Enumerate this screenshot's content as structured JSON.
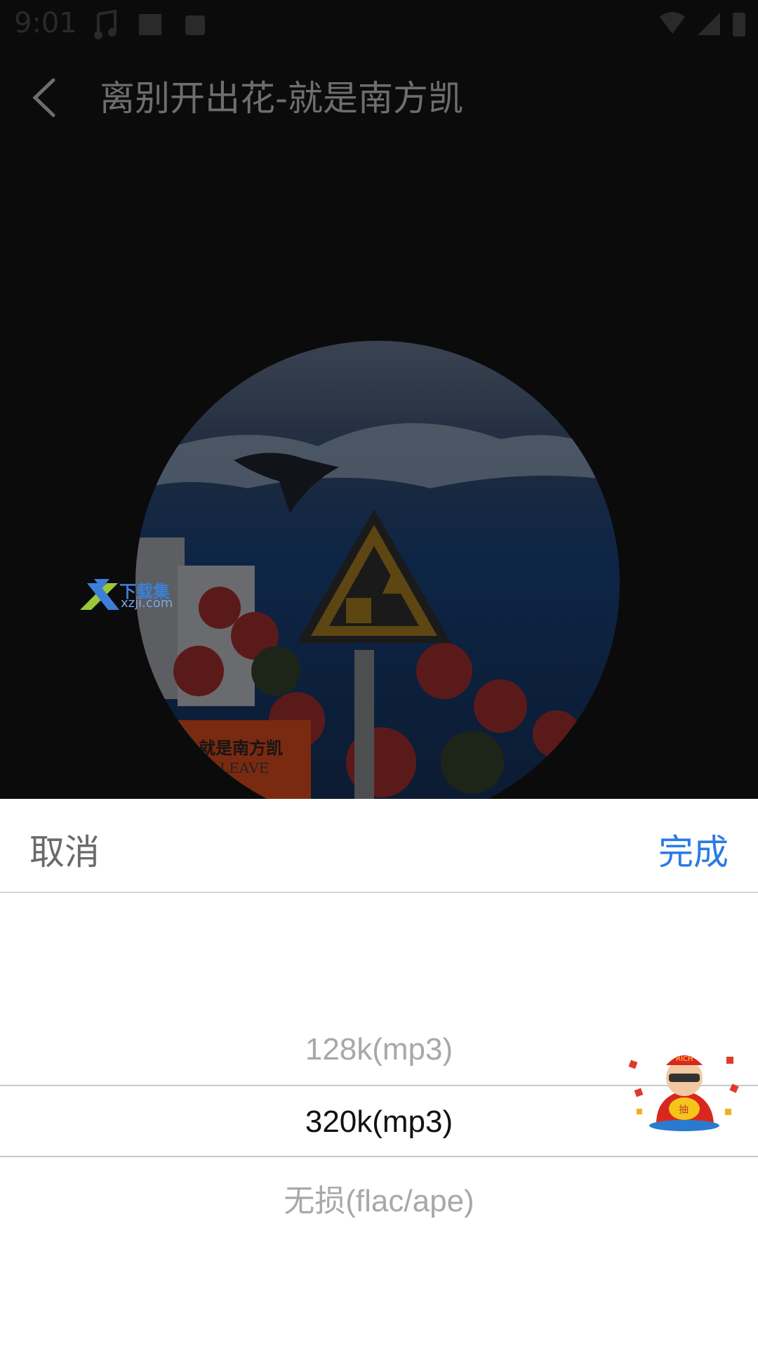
{
  "status_bar": {
    "time": "9:01"
  },
  "header": {
    "title": "离别开出花-就是南方凯"
  },
  "album": {
    "cover_text": "就是南方凯",
    "cover_text2": "LEAVE"
  },
  "watermark": {
    "name": "下载集",
    "domain": "xzji.com"
  },
  "sheet": {
    "cancel_label": "取消",
    "done_label": "完成",
    "options": [
      "128k(mp3)",
      "320k(mp3)",
      "无损(flac/ape)"
    ],
    "selected": "320k(mp3)"
  },
  "promo": {
    "badge_text": "RICH",
    "char": "抽"
  },
  "colors": {
    "accent": "#2a7be4",
    "sheet_bg": "#ffffff",
    "backdrop": "#0b0b0c"
  }
}
